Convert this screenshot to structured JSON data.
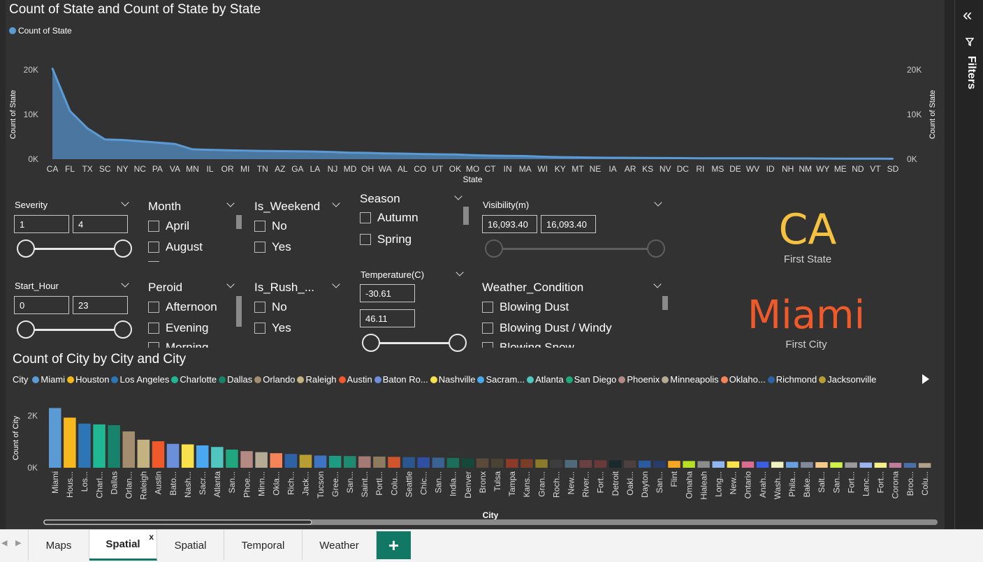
{
  "state_chart": {
    "title": "Count of State and Count of State by State",
    "legend_label": "Count of State",
    "y_label": "Count of State",
    "x_label": "State",
    "y_ticks": [
      "20K",
      "10K",
      "0K"
    ],
    "color": "#5b9bd5"
  },
  "slicers": {
    "severity": {
      "title": "Severity",
      "min": "1",
      "max": "4"
    },
    "start_hour": {
      "title": "Start_Hour",
      "min": "0",
      "max": "23"
    },
    "month": {
      "title": "Month",
      "items": [
        "April",
        "August"
      ]
    },
    "peroid": {
      "title": "Peroid",
      "items": [
        "Afternoon",
        "Evening",
        "Morning"
      ]
    },
    "is_weekend": {
      "title": "Is_Weekend",
      "items": [
        "No",
        "Yes"
      ]
    },
    "is_rush": {
      "title": "Is_Rush_...",
      "items": [
        "No",
        "Yes"
      ]
    },
    "season": {
      "title": "Season",
      "items": [
        "Autumn",
        "Spring"
      ]
    },
    "temperature": {
      "title": "Temperature(C)",
      "min": "-30.61",
      "max": "46.11"
    },
    "visibility": {
      "title": "Visibility(m)",
      "min": "16,093.40",
      "max": "16,093.40"
    },
    "weather": {
      "title": "Weather_Condition",
      "items": [
        "Blowing Dust",
        "Blowing Dust / Windy",
        "Blowing Snow"
      ]
    }
  },
  "cards": {
    "first_state": {
      "value": "CA",
      "label": "First State",
      "color": "#f4c141"
    },
    "first_city": {
      "value": "Miami",
      "label": "First City",
      "color": "#f05a2a"
    }
  },
  "city_chart": {
    "title": "Count of City by City and City",
    "legend_title": "City",
    "legend_items": [
      {
        "name": "Miami",
        "color": "#5b9bd5"
      },
      {
        "name": "Houston",
        "color": "#f6b81c"
      },
      {
        "name": "Los Angeles",
        "color": "#2e75b6"
      },
      {
        "name": "Charlotte",
        "color": "#1fb893"
      },
      {
        "name": "Dallas",
        "color": "#17836b"
      },
      {
        "name": "Orlando",
        "color": "#a48d6e"
      },
      {
        "name": "Raleigh",
        "color": "#c4b280"
      },
      {
        "name": "Austin",
        "color": "#f05a2a"
      },
      {
        "name": "Baton Ro...",
        "color": "#6c8fdb"
      },
      {
        "name": "Nashville",
        "color": "#f8e14b"
      },
      {
        "name": "Sacram...",
        "color": "#4aa8f0"
      },
      {
        "name": "Atlanta",
        "color": "#4fc7c0"
      },
      {
        "name": "San Diego",
        "color": "#21a77f"
      },
      {
        "name": "Phoenix",
        "color": "#b48a85"
      },
      {
        "name": "Minneapolis",
        "color": "#b5aa93"
      },
      {
        "name": "Oklaho...",
        "color": "#f58559"
      },
      {
        "name": "Richmond",
        "color": "#2f62a5"
      },
      {
        "name": "Jacksonville",
        "color": "#b89d33"
      }
    ],
    "y_label": "Count of City",
    "x_label": "City",
    "y_ticks": [
      "2K",
      "0K"
    ]
  },
  "chart_data": [
    {
      "type": "area",
      "title": "Count of State and Count of State by State",
      "xlabel": "State",
      "ylabel": "Count of State",
      "ylim": [
        0,
        20000
      ],
      "categories": [
        "CA",
        "FL",
        "TX",
        "SC",
        "NY",
        "NC",
        "PA",
        "VA",
        "MN",
        "IL",
        "OR",
        "MI",
        "TN",
        "AZ",
        "GA",
        "LA",
        "NJ",
        "MD",
        "OH",
        "WA",
        "AL",
        "CO",
        "UT",
        "OK",
        "MO",
        "CT",
        "IN",
        "MA",
        "WI",
        "KY",
        "MT",
        "NE",
        "IA",
        "AR",
        "KS",
        "NV",
        "DC",
        "RI",
        "MS",
        "DE",
        "WV",
        "ID",
        "NH",
        "NM",
        "WY",
        "ME",
        "ND",
        "VT",
        "SD"
      ],
      "series": [
        {
          "name": "Count of State",
          "values": [
            20300,
            10800,
            6900,
            4400,
            4300,
            4000,
            3700,
            3400,
            2200,
            2100,
            2000,
            1900,
            1850,
            1800,
            1750,
            1700,
            1600,
            1450,
            1400,
            1300,
            1250,
            1150,
            1100,
            1050,
            900,
            800,
            750,
            700,
            550,
            450,
            400,
            350,
            320,
            300,
            280,
            250,
            230,
            210,
            200,
            190,
            180,
            170,
            160,
            150,
            140,
            130,
            120,
            110,
            100
          ]
        }
      ]
    },
    {
      "type": "bar",
      "title": "Count of City by City and City",
      "xlabel": "City",
      "ylabel": "Count of City",
      "ylim": [
        0,
        2500
      ],
      "categories": [
        "Miami",
        "Hous...",
        "Los...",
        "Charl...",
        "Dallas",
        "Orlan...",
        "Raleigh",
        "Austin",
        "Bato...",
        "Nash...",
        "Sacr...",
        "Atlanta",
        "San...",
        "Phoe...",
        "Minn...",
        "Okla...",
        "Rich...",
        "Jack...",
        "Tucson",
        "Gree...",
        "San...",
        "Saint...",
        "Portl...",
        "Colu...",
        "Seattle",
        "Chic...",
        "San...",
        "India...",
        "Denver",
        "Bronx",
        "Tulsa",
        "Tampa",
        "Kans...",
        "Gran...",
        "Roch...",
        "New...",
        "River...",
        "Fort...",
        "Detroit",
        "Oakl...",
        "Dayton",
        "San...",
        "Flint",
        "Omaha",
        "Hialeah",
        "Long...",
        "New...",
        "Ontario",
        "Anah...",
        "Wash...",
        "Phila...",
        "Bake...",
        "Salt...",
        "San...",
        "Fort...",
        "Lanc...",
        "Fort...",
        "Corona",
        "Broo...",
        "Colu..."
      ],
      "values": [
        2300,
        1930,
        1700,
        1670,
        1640,
        1400,
        1080,
        1020,
        920,
        900,
        860,
        800,
        700,
        640,
        600,
        560,
        530,
        500,
        470,
        460,
        450,
        440,
        430,
        420,
        410,
        400,
        390,
        380,
        370,
        360,
        350,
        340,
        330,
        320,
        310,
        300,
        295,
        290,
        285,
        280,
        275,
        270,
        265,
        260,
        255,
        250,
        245,
        240,
        235,
        230,
        225,
        220,
        215,
        210,
        205,
        200,
        195,
        190,
        185,
        180
      ],
      "colors": [
        "#5b9bd5",
        "#f6b81c",
        "#2e75b6",
        "#1fb893",
        "#17836b",
        "#a48d6e",
        "#c4b280",
        "#f05a2a",
        "#6c8fdb",
        "#f8e14b",
        "#4aa8f0",
        "#4fc7c0",
        "#21a77f",
        "#b48a85",
        "#b5aa93",
        "#f58559",
        "#2f62a5",
        "#b89d33",
        "#3e74c4",
        "#1e9a83",
        "#208a70",
        "#a67a74",
        "#8c7b5f",
        "#d0552d",
        "#2b5791",
        "#2f4fa3",
        "#3a6394",
        "#1d6d5b",
        "#14483b",
        "#5b4a3a",
        "#4a4233",
        "#8c3a2a",
        "#7a3d2a",
        "#8a7a2a",
        "#3e3e3e",
        "#4f6a7a",
        "#6a4040",
        "#6a3a3a",
        "#1a2a2a",
        "#4d4040",
        "#2c5a9e",
        "#2a3c6a",
        "#f5a623",
        "#b6e023",
        "#8c8c8c",
        "#8fb6f0",
        "#f8e14b",
        "#d96c8f",
        "#3c5ee0",
        "#f0f0c0",
        "#6aa0e0",
        "#808a9a",
        "#f5c98a",
        "#d0f04a",
        "#9a9a9a",
        "#9bb3f0",
        "#f7f08a",
        "#c07a9a",
        "#4a6ea8",
        "#b0a08a"
      ]
    }
  ]
}
